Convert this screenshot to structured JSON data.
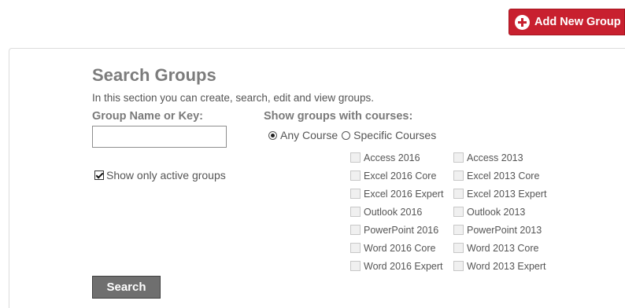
{
  "header": {
    "add_group_label": "Add New Group",
    "add_group_icon": "plus-circle-icon",
    "add_group_color": "#c8202f"
  },
  "search": {
    "title": "Search Groups",
    "description": "In this section you can create, search, edit and view groups.",
    "name_label": "Group Name or Key:",
    "name_value": "",
    "name_placeholder": "",
    "courses_label": "Show groups with courses:",
    "radio_any_label": "Any Course",
    "radio_specific_label": "Specific Courses",
    "selected_radio": "Any Course",
    "active_label": "Show only active groups",
    "active_checked": true,
    "courses": [
      "Access 2016",
      "Access 2013",
      "Excel 2016 Core",
      "Excel 2013 Core",
      "Excel 2016 Expert",
      "Excel 2013 Expert",
      "Outlook 2016",
      "Outlook 2013",
      "PowerPoint 2016",
      "PowerPoint 2013",
      "Word 2016 Core",
      "Word 2013 Core",
      "Word 2016 Expert",
      "Word 2013 Expert"
    ],
    "search_button_label": "Search",
    "search_button_color": "#6f6f6f"
  }
}
